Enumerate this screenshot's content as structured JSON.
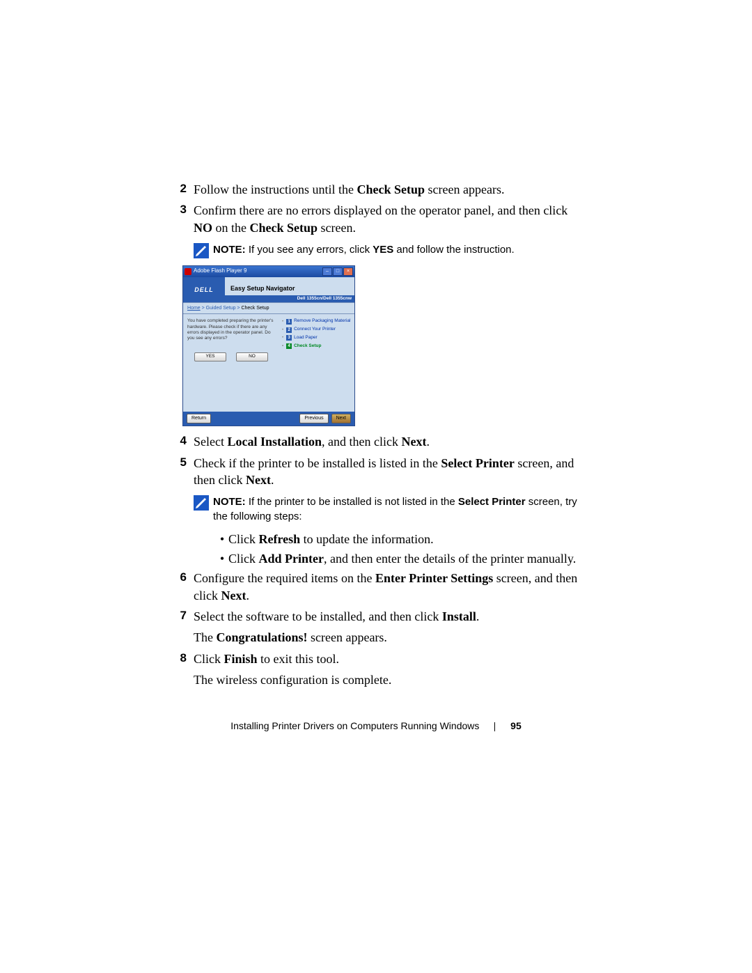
{
  "steps": {
    "s2_num": "2",
    "s2_a": "Follow the instructions until the ",
    "s2_b": "Check Setup",
    "s2_c": " screen appears.",
    "s3_num": "3",
    "s3_a": "Confirm there are no errors displayed on the operator panel, and then click ",
    "s3_b": "NO",
    "s3_c": " on the ",
    "s3_d": "Check Setup",
    "s3_e": " screen.",
    "s4_num": "4",
    "s4_a": "Select ",
    "s4_b": "Local Installation",
    "s4_c": ", and then click ",
    "s4_d": "Next",
    "s4_e": ".",
    "s5_num": "5",
    "s5_a": "Check if the printer to be installed is listed in the ",
    "s5_b": "Select Printer",
    "s5_c": " screen, and then click ",
    "s5_d": "Next",
    "s5_e": ".",
    "s6_num": "6",
    "s6_a": "Configure the required items on the ",
    "s6_b": "Enter Printer Settings",
    "s6_c": " screen, and then click ",
    "s6_d": "Next",
    "s6_e": ".",
    "s7_num": "7",
    "s7_a": "Select the software to be installed, and then click ",
    "s7_b": "Install",
    "s7_c": ".",
    "s7_line2a": "The ",
    "s7_line2b": "Congratulations!",
    "s7_line2c": " screen appears.",
    "s8_num": "8",
    "s8_a": "Click ",
    "s8_b": "Finish",
    "s8_c": " to exit this tool.",
    "s8_line2": "The wireless configuration is complete."
  },
  "note1": {
    "label": "NOTE:",
    "a": " If you see any errors, click ",
    "b": "YES",
    "c": " and follow the instruction."
  },
  "note2": {
    "label": "NOTE:",
    "a": "  If the printer to be installed is not listed in the ",
    "b": "Select Printer",
    "c": " screen, try the following steps:"
  },
  "bullets": {
    "b1a": "Click ",
    "b1b": "Refresh",
    "b1c": " to update the information.",
    "b2a": "Click ",
    "b2b": "Add Printer",
    "b2c": ", and then enter the details of the printer manually."
  },
  "screenshot": {
    "window_title": "Adobe Flash Player 9",
    "dell": "DELL",
    "nav_title": "Easy Setup Navigator",
    "product": "Dell 1355cn/Dell 1355cnw",
    "crumb_home": "Home",
    "crumb_guided": "Guided Setup",
    "crumb_check": "Check Setup",
    "crumb_sep": " > ",
    "prep": "You have completed preparing the printer's hardware. Please check if there are any errors displayed in the operator panel. Do you see any errors?",
    "yes": "YES",
    "no": "NO",
    "items": {
      "n1": "1",
      "t1": "Remove Packaging Material",
      "n2": "2",
      "t2": "Connect Your Printer",
      "n3": "3",
      "t3": "Load Paper",
      "n4": "4",
      "t4": "Check Setup"
    },
    "return": "Return",
    "previous": "Previous",
    "next": "Next"
  },
  "footer": {
    "text": "Installing Printer Drivers on Computers Running Windows",
    "page": "95"
  }
}
